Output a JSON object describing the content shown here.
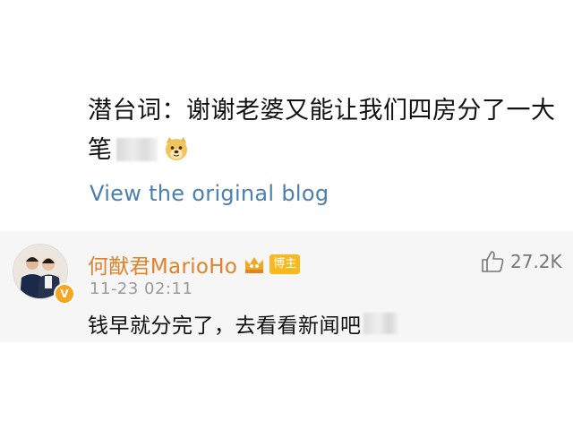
{
  "post": {
    "line1": "潜台词：谢谢老婆又能让我们四房分了一大",
    "line2": "笔",
    "emoji": "doge-icon"
  },
  "view_link": "View the original blog",
  "comment": {
    "avatar": "avatar-icon",
    "verified_badge": "V",
    "name": "何猷君MarioHo",
    "vip_icon": "vip-crown-icon",
    "author_badge": "博主",
    "time": "11-23 02:11",
    "text": "钱早就分完了，去看看新闻吧",
    "likes": "27.2K"
  },
  "colors": {
    "link": "#4a7fb0",
    "username": "#e0822a",
    "badge": "#f7b91e",
    "comment_bg": "#f6f6f6"
  }
}
